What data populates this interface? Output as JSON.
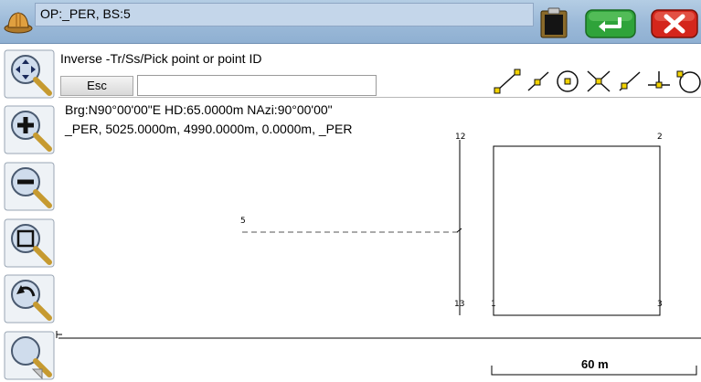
{
  "titlebar": {
    "title": "OP:_PER, BS:5",
    "app_icon": "hard-hat-icon",
    "clipboard_icon": "clipboard-icon",
    "enter_icon": "enter-icon",
    "close_icon": "close-icon",
    "colors": {
      "enter": "#2fa33a",
      "close": "#d4261c"
    }
  },
  "toolbar": {
    "buttons": [
      {
        "name": "pan",
        "icon": "pan-magnifier-icon"
      },
      {
        "name": "zoom-in",
        "icon": "zoom-in-magnifier-icon"
      },
      {
        "name": "zoom-out",
        "icon": "zoom-out-magnifier-icon"
      },
      {
        "name": "zoom-window",
        "icon": "zoom-window-magnifier-icon"
      },
      {
        "name": "zoom-previous",
        "icon": "zoom-previous-magnifier-icon"
      },
      {
        "name": "zoom-extents",
        "icon": "zoom-extents-magnifier-icon"
      }
    ]
  },
  "command": {
    "prompt": "Inverse -Tr/Ss/Pick point or point ID",
    "esc_label": "Esc",
    "input_value": ""
  },
  "snap_modes": [
    {
      "name": "endpoint",
      "icon": "endpoint-snap-icon"
    },
    {
      "name": "midpoint",
      "icon": "midpoint-snap-icon"
    },
    {
      "name": "center",
      "icon": "center-snap-icon"
    },
    {
      "name": "intersection",
      "icon": "intersection-snap-icon"
    },
    {
      "name": "nearest",
      "icon": "nearest-snap-icon"
    },
    {
      "name": "perpendicular",
      "icon": "perpendicular-snap-icon"
    },
    {
      "name": "tangent",
      "icon": "tangent-snap-icon"
    }
  ],
  "info": {
    "line1": "Brg:N90°00'00\"E HD:65.0000m NAzi:90°00'00\"",
    "line2": "_PER, 5025.0000m, 4990.0000m, 0.0000m, _PER"
  },
  "drawing": {
    "point_labels": {
      "p12": "12",
      "p5": "5",
      "p13": "13",
      "p1": "1",
      "p3": "3",
      "p2": "2"
    },
    "scale_label": "60 m",
    "line_color": "#000000",
    "dash_color": "#555555"
  }
}
